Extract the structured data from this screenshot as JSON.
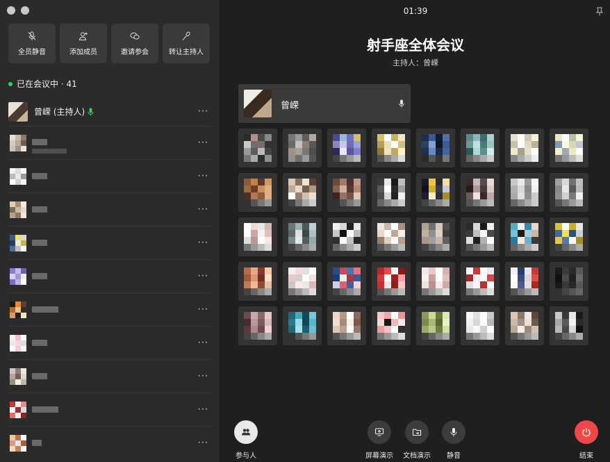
{
  "sidebar": {
    "actions": [
      {
        "label": "全员静音",
        "icon": "mic-off-icon"
      },
      {
        "label": "添加成员",
        "icon": "add-user-icon"
      },
      {
        "label": "邀请参会",
        "icon": "invite-icon"
      },
      {
        "label": "转让主持人",
        "icon": "transfer-host-icon"
      }
    ],
    "in_meeting_text": "已在会议中 · 41",
    "host": {
      "name": "曾嵘 (主持人)"
    },
    "participants": [
      {
        "colors": [
          "#e4ded6",
          "#c9b9ab",
          "#8d7a6c",
          "#d7cbc0",
          "#b7a89a",
          "#6d5e52",
          "#cfc3b8",
          "#a39282",
          "#e9e3dc"
        ],
        "name_w": 22,
        "has_sub": true
      },
      {
        "colors": [
          "#f2f2f2",
          "#dcdcdc",
          "#ffffff",
          "#bcbcbc",
          "#e8e8e8",
          "#9a9a9a",
          "#ffffff",
          "#d2d2d2",
          "#f6f6f6"
        ],
        "name_w": 22,
        "has_sub": false
      },
      {
        "colors": [
          "#d9cfc2",
          "#a88f72",
          "#f1e9dd",
          "#7f6a54",
          "#cbb99e",
          "#e3d9cb",
          "#b4a38c",
          "#8a7864",
          "#efe6d8"
        ],
        "name_w": 22,
        "has_sub": false
      },
      {
        "colors": [
          "#3b5b88",
          "#f3e06a",
          "#d8d8d8",
          "#263e62",
          "#e9e9e9",
          "#c9b44a",
          "#4a6e9c",
          "#bebebe",
          "#ffffff"
        ],
        "name_w": 22,
        "has_sub": false
      },
      {
        "colors": [
          "#8a7bd1",
          "#c6b8f0",
          "#6f5fb3",
          "#d9d1f7",
          "#a396df",
          "#efe9ff",
          "#7d6cc0",
          "#bfb2ea",
          "#ffffff"
        ],
        "name_w": 22,
        "has_sub": false
      },
      {
        "colors": [
          "#1e1716",
          "#e38b3c",
          "#5e3c2e",
          "#b46a33",
          "#f0c08a",
          "#3a2a22",
          "#d99b60",
          "#2a201c",
          "#f4e2c8"
        ],
        "name_w": 38,
        "has_sub": false
      },
      {
        "colors": [
          "#f2f2f2",
          "#f0c0c8",
          "#ffffff",
          "#e8e8e8",
          "#f8d6dc",
          "#dcdcdc",
          "#ffffff",
          "#f3cbd2",
          "#f6f6f6"
        ],
        "name_w": 22,
        "has_sub": false
      },
      {
        "colors": [
          "#cfc8c2",
          "#8e7f76",
          "#ece6e0",
          "#b2a59c",
          "#6f625a",
          "#ddd5ce",
          "#9b8d84",
          "#f3eeea",
          "#c0b4ab"
        ],
        "name_w": 22,
        "has_sub": false
      },
      {
        "colors": [
          "#c23a3a",
          "#f0f0f0",
          "#e58d8d",
          "#ffffff",
          "#a32c2c",
          "#dcdcdc",
          "#e56b6b",
          "#f4f4f4",
          "#8a2525"
        ],
        "name_w": 38,
        "has_sub": false
      },
      {
        "colors": [
          "#f0c8a6",
          "#b8774e",
          "#ffffff",
          "#d89c72",
          "#e6e6e6",
          "#a5623e",
          "#f4d9c0",
          "#c5835a",
          "#ffffff"
        ],
        "name_w": 14,
        "has_sub": false
      }
    ]
  },
  "main": {
    "time": "01:39",
    "title": "射手座全体会议",
    "host_line": "主持人：曾嵘",
    "speaker_name": "曾嵘",
    "tiles": [
      [
        "#2a2a2a",
        "#b58e8e",
        "#4a4a4a",
        "#888",
        "#c9c9c9",
        "#6e6e6e",
        "#7b6b6b",
        "#333",
        "#9a9a9a",
        "#5d5d5d",
        "#bbb",
        "#444",
        "#777",
        "#aaa",
        "#2d2d2d",
        "#8f8f8f"
      ],
      [
        "#777",
        "#9a9a9a",
        "#5d5d5d",
        "#b3a8a0",
        "#6a6a6a",
        "#c8c0b8",
        "#8a8078",
        "#5c5550",
        "#9d9189",
        "#a79e97",
        "#777",
        "#4e4e4e",
        "#8f8f8f",
        "#6f6f6f",
        "#999",
        "#555"
      ],
      [
        "#4a4a8e",
        "#9bb7d8",
        "#7070c0",
        "#d0c070",
        "#8888bb",
        "#c8c8e8",
        "#6f6fb0",
        "#a0a0d8",
        "#2b2b5b",
        "#e8e8f8",
        "#5656a0",
        "#8080c8",
        "#444",
        "#777",
        "#999",
        "#bbb"
      ],
      [
        "#d8c070",
        "#ffffff",
        "#c8b060",
        "#f0e8c0",
        "#b8a050",
        "#e8e0b0",
        "#fff",
        "#d0c088",
        "#8f7a3a",
        "#ede5c2",
        "#c0aa5e",
        "#fff3cc",
        "#555",
        "#888",
        "#aaa",
        "#ddd"
      ],
      [
        "#1e2f4e",
        "#3a5a8e",
        "#0e1a2e",
        "#5070a8",
        "#2a4068",
        "#88a0c8",
        "#101828",
        "#3c5c90",
        "#203050",
        "#6888c0",
        "#1a2a48",
        "#4464a0",
        "#2a2a2a",
        "#555",
        "#333",
        "#777"
      ],
      [
        "#5a8a8a",
        "#8ab8b8",
        "#3e6a6a",
        "#a8d0d0",
        "#6a9a9a",
        "#c0e0e0",
        "#4a7a7a",
        "#98c4c4",
        "#2e5858",
        "#b0d8d8",
        "#5e8e8e",
        "#d0ecec",
        "#666",
        "#888",
        "#aaa",
        "#ccc"
      ],
      [
        "#e8e0c8",
        "#fff",
        "#d0c8b0",
        "#f8f0d8",
        "#c8c0a8",
        "#ffffff",
        "#e0d8c0",
        "#b8b098",
        "#f0e8d0",
        "#a8a088",
        "#e8e0c8",
        "#fff",
        "#888",
        "#aaa",
        "#ccc",
        "#eee"
      ],
      [
        "#e8e8c0",
        "#fff",
        "#b8c0a0",
        "#f8f8d8",
        "#8898b0",
        "#fff8e0",
        "#d8d8b0",
        "#c0c8d8",
        "#f0f0d0",
        "#a0a8b8",
        "#e8e8c8",
        "#fff",
        "#777",
        "#999",
        "#bbb",
        "#ddd"
      ],
      [
        "#8a5a3a",
        "#c0804a",
        "#5a3a2a",
        "#d09868",
        "#a0683e",
        "#703e28",
        "#c88e60",
        "#e0b080",
        "#4e3020",
        "#b47850",
        "#8c5c3c",
        "#ddb088",
        "#333",
        "#555",
        "#777",
        "#999"
      ],
      [
        "#d8c8b8",
        "#8a7060",
        "#f0e0d0",
        "#5a4030",
        "#c0a898",
        "#e8d8c8",
        "#706050",
        "#b09888",
        "#fff",
        "#9a8070",
        "#d0c0b0",
        "#e8e0d8",
        "#444",
        "#777",
        "#aaa",
        "#ccc"
      ],
      [
        "#6a4a3a",
        "#a07a6a",
        "#4a3028",
        "#c09888",
        "#8a6050",
        "#d0b0a0",
        "#583a30",
        "#b08878",
        "#382620",
        "#987060",
        "#74524a",
        "#e0c8b8",
        "#333",
        "#555",
        "#777",
        "#999"
      ],
      [
        "#3a3a3a",
        "#e8e8e8",
        "#1a1a1a",
        "#c0c0c0",
        "#5a5a5a",
        "#ffffff",
        "#2a2a2a",
        "#a0a0a0",
        "#4a4a4a",
        "#d8d8d8",
        "#222",
        "#f0f0f0",
        "#666",
        "#888",
        "#aaa",
        "#ccc"
      ],
      [
        "#1a1a2a",
        "#e8c840",
        "#2a2a3a",
        "#f0e0a0",
        "#101020",
        "#d0b030",
        "#3a3a4a",
        "#c8c8d8",
        "#1e1e2e",
        "#f8f0c8",
        "#2e2e3e",
        "#a89020",
        "#444",
        "#666",
        "#888",
        "#aaa"
      ],
      [
        "#3a2a2a",
        "#c8b8b8",
        "#5a4a4a",
        "#e8d8d8",
        "#2a1a1a",
        "#a89898",
        "#4a3a3a",
        "#d8c8c8",
        "#6a5a5a",
        "#f0e0e0",
        "#382828",
        "#b8a8a8",
        "#555",
        "#777",
        "#999",
        "#bbb"
      ],
      [
        "#c8c8c8",
        "#e8e8e8",
        "#9a9a9a",
        "#f8f8f8",
        "#b0b0b0",
        "#d8d8d8",
        "#888",
        "#f0f0f0",
        "#a8a8a8",
        "#e0e0e0",
        "#909090",
        "#cccccc",
        "#666",
        "#888",
        "#aaa",
        "#ccc"
      ],
      [
        "#a0a0a0",
        "#d8d8d8",
        "#707070",
        "#c0c0c0",
        "#888",
        "#e8e8e8",
        "#5a5a5a",
        "#b8b8b8",
        "#909090",
        "#d0d0d0",
        "#787878",
        "#f0f0f0",
        "#555",
        "#777",
        "#999",
        "#bbb"
      ],
      [
        "#ffffff",
        "#f0d8d8",
        "#e8e8e8",
        "#d8b8b8",
        "#fff",
        "#c8a8a8",
        "#f4f4f4",
        "#e0c0c0",
        "#ddd",
        "#b89898",
        "#fff",
        "#f8e8e8",
        "#777",
        "#999",
        "#bbb",
        "#ddd"
      ],
      [
        "#6a7a7a",
        "#a0b0b0",
        "#4a5a5a",
        "#c0d0d0",
        "#5a6a6a",
        "#d8e0e0",
        "#3a4a4a",
        "#b0c0c0",
        "#7a8a8a",
        "#e0e8e8",
        "#505e5e",
        "#98a8a8",
        "#444",
        "#666",
        "#888",
        "#aaa"
      ],
      [
        "#f0f0f0",
        "#d8d8d8",
        "#202020",
        "#e8e8e8",
        "#c8c8c8",
        "#101010",
        "#fafafa",
        "#b8b8b8",
        "#303030",
        "#ffffff",
        "#c0c0c0",
        "#282828",
        "#666",
        "#888",
        "#aaa",
        "#ccc"
      ],
      [
        "#f0e8e0",
        "#c8b8a8",
        "#ffffff",
        "#a89080",
        "#e8d8c8",
        "#ffffff",
        "#c0a898",
        "#f8f0e8",
        "#988070",
        "#e0d0c0",
        "#fff",
        "#b8a090",
        "#555",
        "#777",
        "#999",
        "#bbb"
      ],
      [
        "#b0a090",
        "#707070",
        "#d8c8b8",
        "#505050",
        "#c0b0a0",
        "#909090",
        "#e0d0c0",
        "#404040",
        "#a89888",
        "#a0a0a0",
        "#c8b8a8",
        "#606060",
        "#444",
        "#666",
        "#888",
        "#aaa"
      ],
      [
        "#2a2a2a",
        "#d8d8d8",
        "#1a1a1a",
        "#f0f0f0",
        "#3a3a3a",
        "#c0c0c0",
        "#f8f8f8",
        "#4a4a4a",
        "#e0e0e0",
        "#202020",
        "#b0b0b0",
        "#ffffff",
        "#555",
        "#777",
        "#999",
        "#bbb"
      ],
      [
        "#58a8c8",
        "#f0f0f0",
        "#3888a8",
        "#e8d8c8",
        "#78c0d8",
        "#1a1a1a",
        "#a0d0e0",
        "#c8b8a8",
        "#2878a0",
        "#f8e8d8",
        "#68b0d0",
        "#3a3a3a",
        "#666",
        "#888",
        "#aaa",
        "#ccc"
      ],
      [
        "#d8c040",
        "#ffffff",
        "#c8b030",
        "#e8e8e8",
        "#486898",
        "#f0e060",
        "#305080",
        "#d0d0d0",
        "#e0c850",
        "#5878a8",
        "#fff",
        "#a89020",
        "#444",
        "#666",
        "#888",
        "#aaa"
      ],
      [
        "#b86a4a",
        "#e8a888",
        "#883a2a",
        "#f8c8a8",
        "#a05a3a",
        "#d89878",
        "#703020",
        "#ffe0c8",
        "#c07a5a",
        "#f0b898",
        "#904a32",
        "#e8c0a8",
        "#444",
        "#666",
        "#888",
        "#aaa"
      ],
      [
        "#f0f0f0",
        "#f8d8d8",
        "#e0e0e0",
        "#ffffff",
        "#e8c8c8",
        "#d0d0d0",
        "#fff",
        "#f0e0e0",
        "#c8c8c8",
        "#ffe8e8",
        "#e8e8e8",
        "#d8b8b8",
        "#777",
        "#999",
        "#bbb",
        "#ddd"
      ],
      [
        "#2a4a8a",
        "#c84a5a",
        "#5070b0",
        "#e87080",
        "#1a3a7a",
        "#f0f0f0",
        "#a83848",
        "#3a5a9a",
        "#d0d0e0",
        "#e06070",
        "#4060a0",
        "#f8d0d8",
        "#444",
        "#666",
        "#888",
        "#aaa"
      ],
      [
        "#b82828",
        "#e84848",
        "#f8f8f8",
        "#8a1818",
        "#d83838",
        "#ffffff",
        "#a02020",
        "#f0a0a0",
        "#c83030",
        "#e8e8e8",
        "#901c1c",
        "#f8c8c8",
        "#555",
        "#777",
        "#999",
        "#bbb"
      ],
      [
        "#f0e8e8",
        "#e8c8c8",
        "#ffffff",
        "#d8b0b0",
        "#f8f0f0",
        "#c8a0a0",
        "#fff",
        "#e0c0c0",
        "#f0e0e0",
        "#b89090",
        "#f8e8e8",
        "#d0a8a8",
        "#777",
        "#999",
        "#bbb",
        "#ddd"
      ],
      [
        "#f8f8f8",
        "#c83838",
        "#ffffff",
        "#e8e8e8",
        "#a82828",
        "#f0f0f0",
        "#fff",
        "#d84848",
        "#e0e0e0",
        "#f8f8f8",
        "#b83030",
        "#ffffff",
        "#777",
        "#999",
        "#bbb",
        "#ddd"
      ],
      [
        "#f0f0f0",
        "#2a3a6a",
        "#e8e8e8",
        "#c83838",
        "#ffffff",
        "#3a4a7a",
        "#d8d8d8",
        "#e84848",
        "#f8f8f8",
        "#4a5a8a",
        "#e0e0e0",
        "#a82828",
        "#555",
        "#777",
        "#999",
        "#bbb"
      ],
      [
        "#1a1a1a",
        "#3a3a3a",
        "#2a2a2a",
        "#5a5a5a",
        "#101010",
        "#4a4a4a",
        "#202020",
        "#6a6a6a",
        "#181818",
        "#383838",
        "#282828",
        "#585858",
        "#333",
        "#444",
        "#555",
        "#666"
      ],
      [
        "#6a4a4a",
        "#c8a8a8",
        "#8a6a6a",
        "#e8c8c8",
        "#4a2a2a",
        "#b89898",
        "#7a5a5a",
        "#d8b8b8",
        "#5a3a3a",
        "#a88888",
        "#6a4a4a",
        "#f0d0d0",
        "#444",
        "#666",
        "#888",
        "#aaa"
      ],
      [
        "#1a6a7a",
        "#48a8b8",
        "#0a4a5a",
        "#78c8d8",
        "#2a7a8a",
        "#98d8e8",
        "#104858",
        "#58b8c8",
        "#206878",
        "#a8e0e8",
        "#186070",
        "#68c0d0",
        "#333",
        "#555",
        "#777",
        "#999"
      ],
      [
        "#e8d8c8",
        "#b89888",
        "#ffffff",
        "#8a6a5a",
        "#f0e0d0",
        "#a88878",
        "#f8f0e8",
        "#7a5a4a",
        "#e0c8b8",
        "#c0a090",
        "#fff",
        "#98786a",
        "#555",
        "#777",
        "#999",
        "#bbb"
      ],
      [
        "#f8c8c8",
        "#f0a8a8",
        "#ffffff",
        "#e89898",
        "#f8d8d8",
        "#1a1a1a",
        "#f0b8b8",
        "#ffe8e8",
        "#e8a0a0",
        "#f8c0c0",
        "#fff",
        "#303030",
        "#777",
        "#999",
        "#bbb",
        "#ddd"
      ],
      [
        "#8a9a5a",
        "#c8d898",
        "#6a7a3a",
        "#d8e8b8",
        "#7a8a4a",
        "#a8b878",
        "#5a6a2a",
        "#e8f0c8",
        "#9aaa6a",
        "#b8c888",
        "#6e7e3e",
        "#d0e0a0",
        "#444",
        "#666",
        "#888",
        "#aaa"
      ],
      [
        "#f8f8f8",
        "#e0e0e0",
        "#ffffff",
        "#c8c8c8",
        "#f0f0f0",
        "#d8d8d8",
        "#fff",
        "#b8b8b8",
        "#e8e8e8",
        "#f8f8f8",
        "#d0d0d0",
        "#ffffff",
        "#777",
        "#999",
        "#bbb",
        "#ddd"
      ],
      [
        "#d8c8b8",
        "#8a7868",
        "#f0e8e0",
        "#5a4a3a",
        "#c8b8a8",
        "#a09080",
        "#e8e0d8",
        "#6a5a4a",
        "#b8a898",
        "#f8f0e8",
        "#9a8a7a",
        "#d0c0b0",
        "#555",
        "#777",
        "#999",
        "#bbb"
      ],
      [
        "#c8c8c8",
        "#3a3a3a",
        "#e8e8e8",
        "#1a1a1a",
        "#a8a8a8",
        "#5a5a5a",
        "#f0f0f0",
        "#2a2a2a",
        "#b8b8b8",
        "#4a4a4a",
        "#d8d8d8",
        "#101010",
        "#444",
        "#666",
        "#888",
        "#aaa"
      ]
    ]
  },
  "toolbar": {
    "participants_label": "参与人",
    "screen_share_label": "屏幕演示",
    "doc_share_label": "文档演示",
    "mute_label": "静音",
    "end_label": "结束"
  }
}
